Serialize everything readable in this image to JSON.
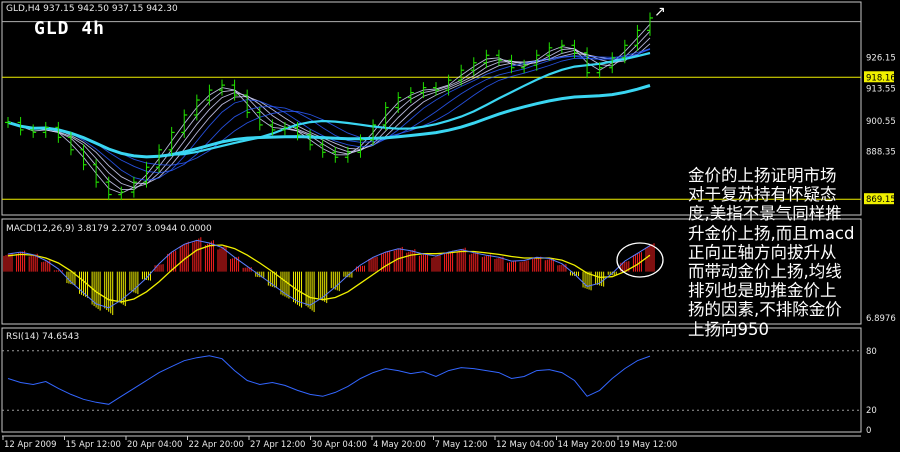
{
  "window": {
    "symbol_header": "GLD,H4  937.15 942.50 937.15 942.30",
    "chart_title": "GLD  4h"
  },
  "panels": {
    "price": {
      "levels": [
        "926.15",
        "918.16",
        "913.55",
        "900.55",
        "888.35",
        "869.15"
      ]
    },
    "macd": {
      "header": "MACD(12,26,9) 3.8179 2.2707 3.0944 0.0000",
      "levels": [
        "6.8976"
      ]
    },
    "rsi": {
      "header": "RSI(14) 74.6543",
      "levels": [
        "80",
        "20",
        "0"
      ]
    }
  },
  "annotation": {
    "text": "金价的上扬证明市场\n对于复苏持有怀疑态\n度,美指不景气同样推\n升金价上扬,而且macd\n正向正轴方向拔升从\n而带动金价上扬,均线\n排列也是助推金价上\n扬的因素,不排除金价\n上扬向950"
  },
  "colors": {
    "background": "#000000",
    "frame": "#c8c8c8",
    "candles": "#22e000",
    "ma_fast": "#2b5cff",
    "ma_slow": "#3ad6f2",
    "support_line": "#f0f000",
    "macd_up": "#ff2020",
    "macd_down": "#f0f000",
    "macd_signal": "#5a7cff",
    "rsi_line": "#3366ff"
  },
  "chart_data": {
    "type": "line",
    "title": "GLD  4h",
    "x_tick_labels": [
      "12 Apr 2009",
      "15 Apr 12:00",
      "20 Apr 04:00",
      "22 Apr 20:00",
      "27 Apr 12:00",
      "30 Apr 04:00",
      "4 May 20:00",
      "7 May 12:00",
      "12 May 04:00",
      "14 May 20:00",
      "19 May 12:00"
    ],
    "price_axis": {
      "min": 864,
      "max": 946
    },
    "horizontal_lines": [
      918.16,
      869.15
    ],
    "price_close": [
      900,
      897,
      896,
      898,
      894,
      889,
      883,
      876,
      871,
      872,
      876,
      882,
      889,
      896,
      903,
      909,
      913,
      915,
      911,
      904,
      899,
      897,
      898,
      895,
      891,
      888,
      886,
      888,
      893,
      899,
      906,
      910,
      912,
      914,
      913,
      917,
      921,
      924,
      927,
      925,
      922,
      923,
      927,
      930,
      931,
      928,
      920,
      922,
      926,
      931,
      937,
      942
    ],
    "macd_axis": {
      "min": -7,
      "max": 6.9
    },
    "macd_hist": [
      2.5,
      2.8,
      2.4,
      1.5,
      0.2,
      -1.8,
      -3.5,
      -5.2,
      -5.8,
      -4.6,
      -3.0,
      -1.2,
      1.0,
      2.8,
      4.0,
      4.6,
      4.2,
      3.5,
      2.0,
      0.6,
      -0.8,
      -2.2,
      -3.6,
      -4.8,
      -5.4,
      -4.2,
      -2.6,
      -0.8,
      0.8,
      2.0,
      2.8,
      3.3,
      3.0,
      2.5,
      2.2,
      2.8,
      3.2,
      2.7,
      2.3,
      2.0,
      1.4,
      1.5,
      2.0,
      1.8,
      1.0,
      -0.6,
      -2.5,
      -2.0,
      -0.5,
      1.4,
      2.6,
      3.8
    ],
    "macd_signal": [
      2.2,
      2.4,
      2.3,
      1.9,
      1.2,
      0.1,
      -1.3,
      -2.8,
      -3.9,
      -4.2,
      -3.8,
      -2.8,
      -1.4,
      0.2,
      1.7,
      3.0,
      3.6,
      3.7,
      3.2,
      2.3,
      1.2,
      0.0,
      -1.3,
      -2.6,
      -3.6,
      -3.9,
      -3.6,
      -2.8,
      -1.6,
      -0.4,
      0.8,
      1.8,
      2.3,
      2.5,
      2.5,
      2.6,
      2.8,
      2.8,
      2.6,
      2.4,
      2.1,
      1.9,
      1.9,
      1.9,
      1.6,
      0.9,
      -0.2,
      -0.8,
      -0.7,
      0.0,
      1.0,
      2.3
    ],
    "rsi_axis": {
      "min": 0,
      "max": 100
    },
    "rsi_levels": [
      80,
      20
    ],
    "rsi": [
      52,
      48,
      46,
      49,
      42,
      36,
      31,
      28,
      26,
      34,
      42,
      50,
      58,
      64,
      70,
      73,
      75,
      72,
      60,
      50,
      46,
      48,
      45,
      40,
      36,
      34,
      38,
      44,
      52,
      58,
      62,
      60,
      57,
      59,
      54,
      60,
      63,
      62,
      60,
      58,
      52,
      54,
      60,
      61,
      58,
      50,
      34,
      40,
      52,
      62,
      70,
      74.65
    ]
  }
}
